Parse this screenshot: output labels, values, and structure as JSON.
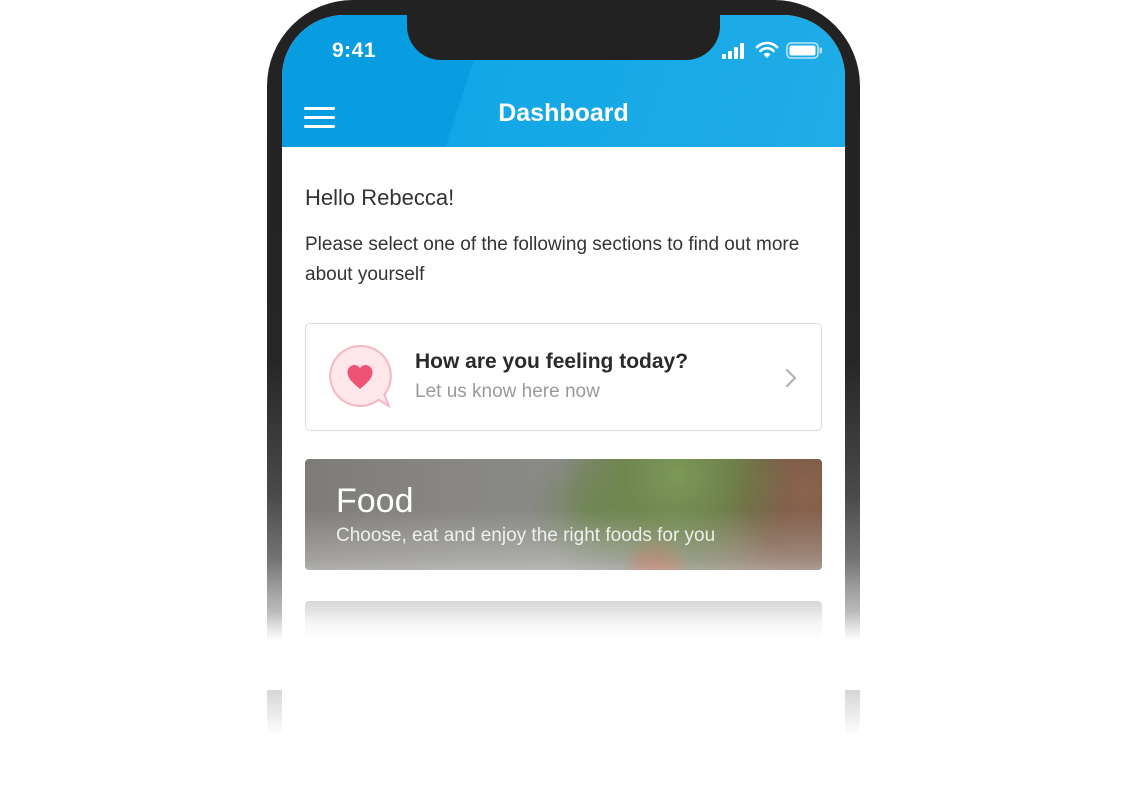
{
  "status_bar": {
    "time": "9:41",
    "icons": [
      "cellular-signal-icon",
      "wifi-icon",
      "battery-icon"
    ]
  },
  "header": {
    "title": "Dashboard",
    "menu_icon": "hamburger-menu-icon",
    "background_color": "#12a7e6"
  },
  "content": {
    "greeting": "Hello Rebecca!",
    "intro": "Please select one of the following sections to find out more about yourself"
  },
  "feeling_card": {
    "icon": "heart-speech-bubble-icon",
    "title": "How are you feeling today?",
    "subtitle": "Let us know here now",
    "chevron_icon": "chevron-right-icon",
    "accent_color": "#ef5275"
  },
  "food_card": {
    "title": "Food",
    "subtitle": "Choose, eat and enjoy the right foods for you"
  }
}
